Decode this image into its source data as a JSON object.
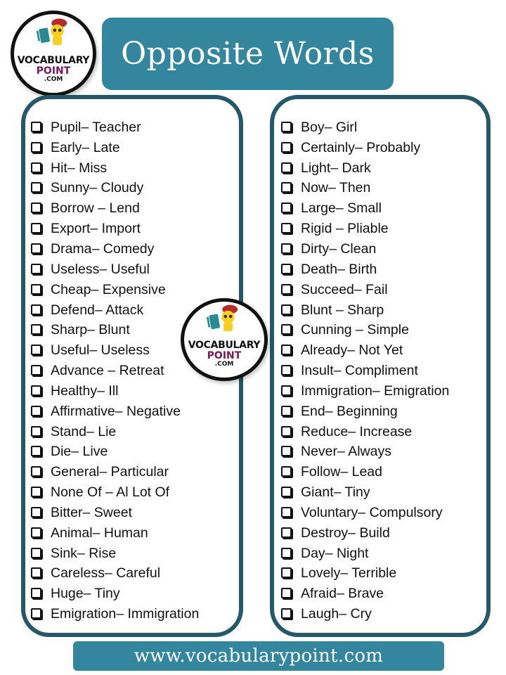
{
  "title": "Opposite Words",
  "logo": {
    "line1": "VOCABULARY",
    "line2": "POINT",
    "line3": ".COM",
    "icon": "mascot-with-book-icon"
  },
  "colors": {
    "banner": "#34869e",
    "panel_border": "#25596a",
    "logo_point": "#7a1a52"
  },
  "left_column": [
    "Pupil– Teacher",
    "Early– Late",
    "Hit– Miss",
    "Sunny– Cloudy",
    "Borrow – Lend",
    "Export– Import",
    "Drama– Comedy",
    "Useless– Useful",
    "Cheap– Expensive",
    "Defend– Attack",
    "Sharp– Blunt",
    "Useful– Useless",
    "Advance – Retreat",
    "Healthy– Ill",
    "Affirmative– Negative",
    "Stand– Lie",
    "Die– Live",
    "General– Particular",
    "None Of – Al Lot Of",
    "Bitter– Sweet",
    "Animal– Human",
    "Sink– Rise",
    "Careless– Careful",
    "Huge– Tiny",
    "Emigration– Immigration"
  ],
  "right_column": [
    "Boy– Girl",
    "Certainly– Probably",
    "Light– Dark",
    "Now– Then",
    "Large– Small",
    "Rigid – Pliable",
    "Dirty– Clean",
    "Death– Birth",
    "Succeed– Fail",
    "Blunt – Sharp",
    "Cunning – Simple",
    "Already– Not Yet",
    "Insult– Compliment",
    "Immigration– Emigration",
    "End– Beginning",
    "Reduce– Increase",
    "Never– Always",
    "Follow– Lead",
    "Giant– Tiny",
    "Voluntary– Compulsory",
    "Destroy– Build",
    "Day– Night",
    "Lovely– Terrible",
    "Afraid– Brave",
    "Laugh– Cry"
  ],
  "footer": "www.vocabularypoint.com"
}
